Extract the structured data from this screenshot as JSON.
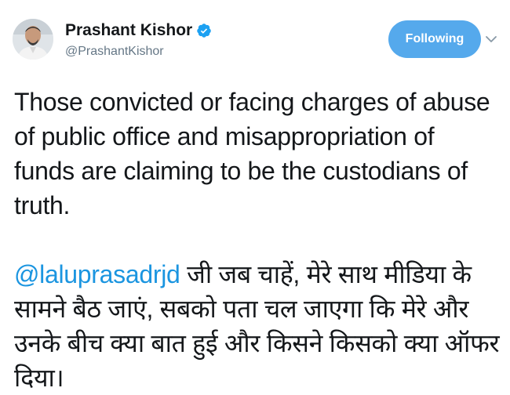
{
  "user": {
    "display_name": "Prashant Kishor",
    "handle": "@PrashantKishor",
    "verified": true,
    "verified_icon": "verified-badge-icon"
  },
  "follow_button": {
    "label": "Following"
  },
  "menu_icon": "chevron-down-icon",
  "tweet": {
    "paragraph1": "Those convicted or facing charges of abuse of public office and misappropriation of funds are claiming to be the custodians of truth.",
    "mention": "@laluprasadrjd",
    "paragraph2_rest": " जी जब चाहें, मेरे साथ मीडिया के सामने बैठ जाएं, सबको पता चल जाएगा कि मेरे और उनके बीच क्या बात हुई और किसने किसको क्या ऑफर दिया।"
  },
  "colors": {
    "accent": "#1b95e0",
    "follow_bg": "#55a9ec",
    "handle": "#657786",
    "text": "#14171a"
  }
}
